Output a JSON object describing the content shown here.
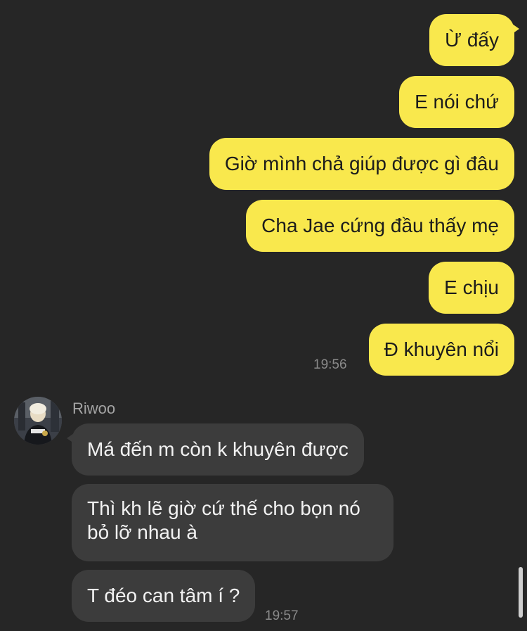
{
  "outgoing": [
    "Ừ đấy",
    "E nói chứ",
    "Giờ mình chả giúp được gì đâu",
    "Cha Jae cứng đầu thấy mẹ",
    "E chịu",
    "Đ khuyên nổi"
  ],
  "outgoing_time": "19:56",
  "sender": {
    "name": "Riwoo",
    "avatar": "profile-photo"
  },
  "incoming": [
    {
      "lines": [
        "Má đến m còn k khuyên được"
      ]
    },
    {
      "lines": [
        "Thì kh lẽ giờ cứ thế cho bọn nó",
        "bỏ lỡ nhau à"
      ]
    },
    {
      "lines": [
        "T đéo can tâm í ?"
      ]
    }
  ],
  "incoming_time": "19:57",
  "colors": {
    "background": "#262626",
    "outgoing_bubble": "#f9e84d",
    "incoming_bubble": "#3c3c3c",
    "timestamp": "#8a8a8a"
  }
}
